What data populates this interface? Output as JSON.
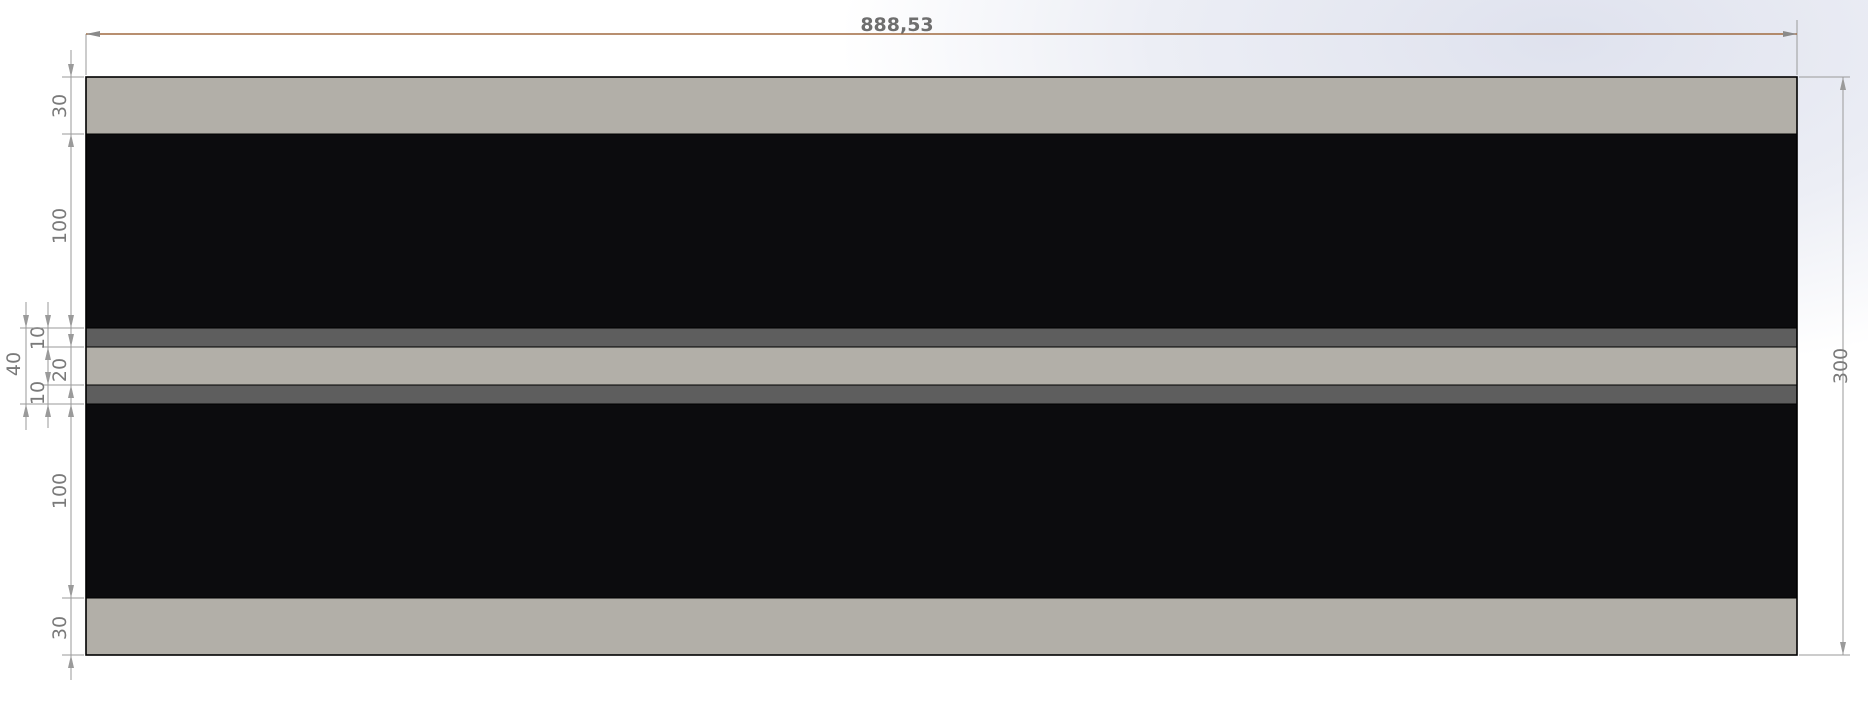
{
  "colors": {
    "outline": "#000000",
    "dim_line": "#9a9a9a",
    "overall_dim_line": "#a06a40",
    "dim_text": "#7a7a7a"
  },
  "bands": [
    {
      "name": "band-top-light",
      "height": 30,
      "color": "#b2afa8"
    },
    {
      "name": "band-upper-black",
      "height": 100,
      "color": "#0c0c0e"
    },
    {
      "name": "band-upper-gray",
      "height": 10,
      "color": "#5e5e5e"
    },
    {
      "name": "band-center-light",
      "height": 20,
      "color": "#b2afa8"
    },
    {
      "name": "band-lower-gray",
      "height": 10,
      "color": "#5e5e5e"
    },
    {
      "name": "band-lower-black",
      "height": 100,
      "color": "#0c0c0e"
    },
    {
      "name": "band-bottom-light",
      "height": 30,
      "color": "#b2afa8"
    }
  ],
  "dimensions": {
    "overall_width": "888,53",
    "overall_height": "300",
    "left_chain": [
      "30",
      "100",
      "10",
      "20",
      "10",
      "100",
      "30"
    ],
    "center_group": "40"
  }
}
